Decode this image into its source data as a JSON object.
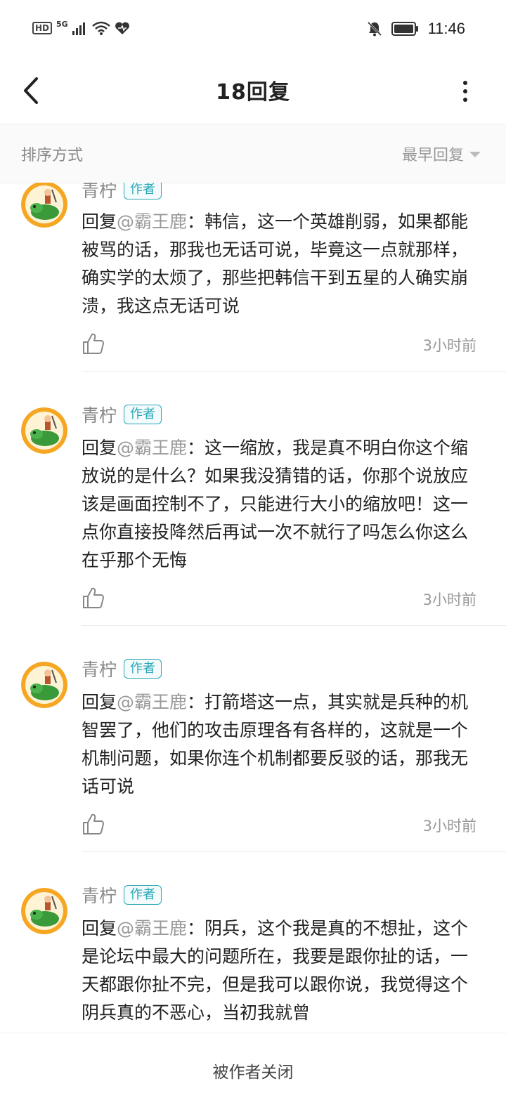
{
  "status": {
    "hd": "HD",
    "network": "5G",
    "time": "11:46",
    "icons": [
      "hd-icon",
      "signal-icon",
      "wifi-icon",
      "heart-icon",
      "bell-off-icon",
      "battery-icon"
    ]
  },
  "header": {
    "title": "18回复"
  },
  "sort": {
    "label": "排序方式",
    "value": "最早回复"
  },
  "colors": {
    "accent": "#2aa7b5",
    "muted": "#999999"
  },
  "replies": [
    {
      "name": "青柠",
      "badge": "作者",
      "prefix": "回复",
      "mention": "@霸王鹿",
      "text": "：韩信，这一个英雄削弱，如果都能被骂的话，那我也无话可说，毕竟这一点就那样，确实学的太烦了，那些把韩信干到五星的人确实崩溃，我这点无话可说",
      "time": "3小时前"
    },
    {
      "name": "青柠",
      "badge": "作者",
      "prefix": "回复",
      "mention": "@霸王鹿",
      "text": "：这一缩放，我是真不明白你这个缩放说的是什么？如果我没猜错的话，你那个说放应该是画面控制不了，只能进行大小的缩放吧！这一点你直接投降然后再试一次不就行了吗怎么你这么在乎那个无悔",
      "time": "3小时前"
    },
    {
      "name": "青柠",
      "badge": "作者",
      "prefix": "回复",
      "mention": "@霸王鹿",
      "text": "：打箭塔这一点，其实就是兵种的机智罢了，他们的攻击原理各有各样的，这就是一个机制问题，如果你连个机制都要反驳的话，那我无话可说",
      "time": "3小时前"
    },
    {
      "name": "青柠",
      "badge": "作者",
      "prefix": "回复",
      "mention": "@霸王鹿",
      "text": "：阴兵，这个我是真的不想扯，这个是论坛中最大的问题所在，我要是跟你扯的话，一天都跟你扯不完，但是我可以跟你说，我觉得这个阴兵真的不恶心，当初我就曾",
      "time": ""
    }
  ],
  "bottom": {
    "closed_text": "被作者关闭"
  }
}
